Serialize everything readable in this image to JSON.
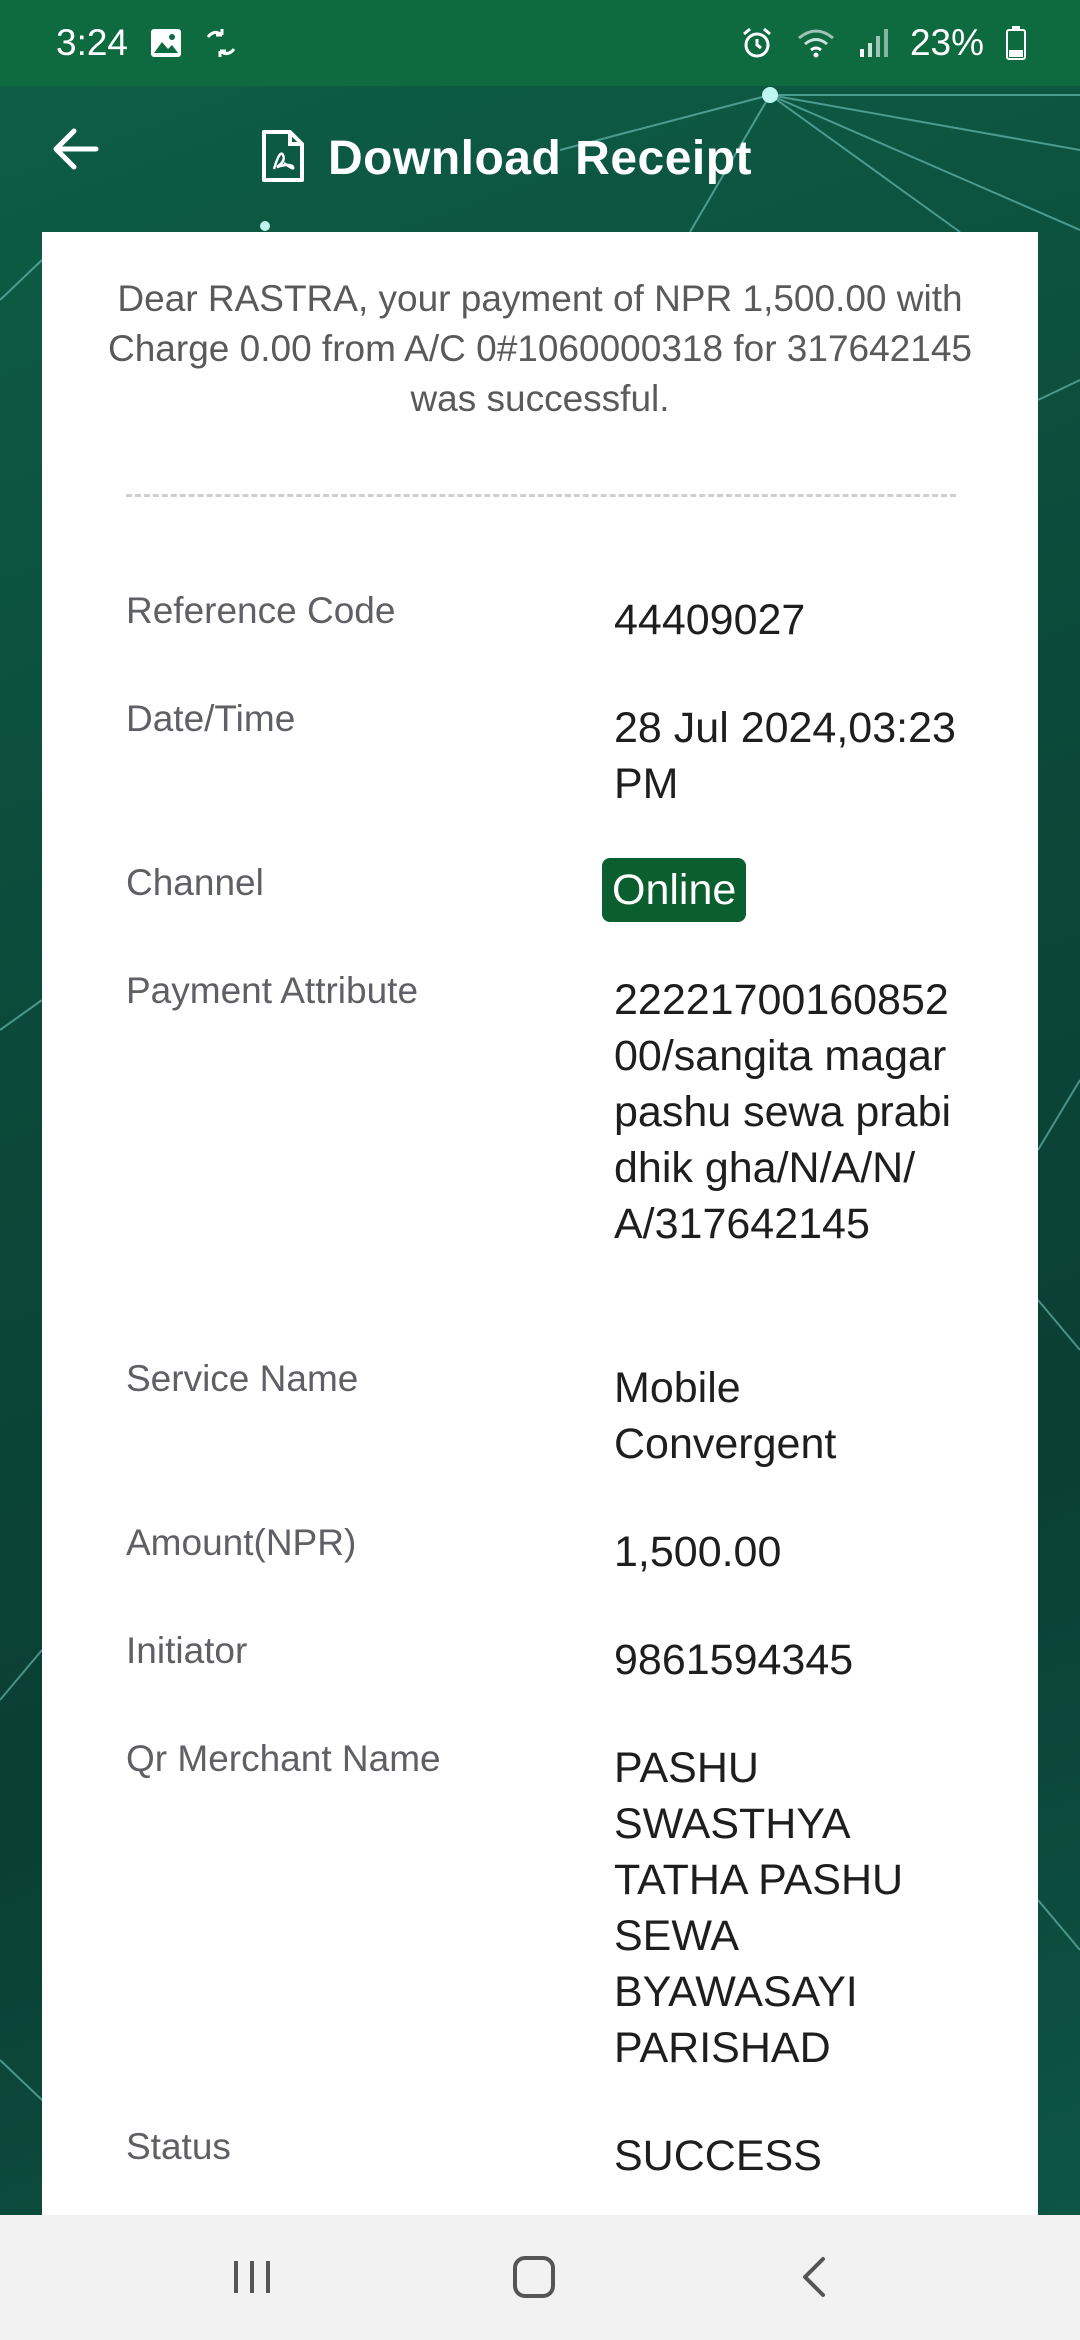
{
  "status_bar": {
    "time": "3:24",
    "battery": "23%",
    "icons": [
      "gallery-icon",
      "sync-icon",
      "alarm-icon",
      "wifi-icon",
      "signal-icon",
      "battery-icon"
    ]
  },
  "header": {
    "title": "Download Receipt",
    "back_icon": "arrow-left-icon",
    "pdf_icon": "pdf-icon"
  },
  "receipt": {
    "message": "Dear RASTRA, your payment of NPR 1,500.00 with Charge 0.00 from A/C 0#1060000318 for 317642145 was successful.",
    "rows": [
      {
        "label": "Reference Code",
        "value": "44409027"
      },
      {
        "label": "Date/Time",
        "value": "28 Jul 2024,03:23 PM"
      },
      {
        "label": "Channel",
        "value": "Online"
      },
      {
        "label": "Payment Attribute",
        "value": "2222170016085200/sangita magar pashu sewa prabidhik gha/N/A/N/A/317642145"
      },
      {
        "label": "Service Name",
        "value": "Mobile Convergent"
      },
      {
        "label": "Amount(NPR)",
        "value": "1,500.00"
      },
      {
        "label": "Initiator",
        "value": "9861594345"
      },
      {
        "label": "Qr Merchant Name",
        "value": "PASHU SWASTHYA TATHA PASHU SEWA BYAWASAYI PARISHAD"
      },
      {
        "label": "Status",
        "value": "SUCCESS"
      }
    ]
  },
  "colors": {
    "status_bar": "#0e6a3f",
    "badge": "#0b5e2e",
    "nav_bar": "#f2f2f2"
  },
  "nav_bar": {
    "icons": [
      "recent-apps-icon",
      "home-icon",
      "back-icon"
    ]
  }
}
